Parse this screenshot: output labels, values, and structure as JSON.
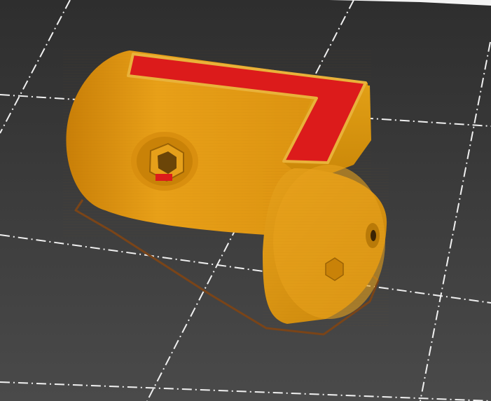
{
  "viewport": {
    "label": "",
    "background_color_top": "#2e2e2e",
    "background_color_bottom": "#4a4a4a",
    "grid_color": "#f2f2f2",
    "grid_style": "dash-dot"
  },
  "model": {
    "body_color": "#e39a14",
    "body_shadow_color": "#b8760a",
    "top_infill_color": "#dc1b1b",
    "skirt_color": "#7a4418"
  },
  "bed_edge": {
    "color": "#f4f4f4"
  }
}
